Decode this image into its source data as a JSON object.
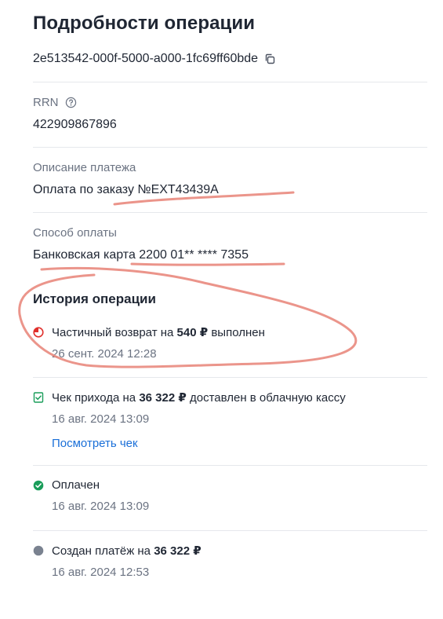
{
  "header": {
    "title": "Подробности операции",
    "operation_id": "2e513542-000f-5000-a000-1fc69ff60bde"
  },
  "rrn": {
    "label": "RRN",
    "value": "422909867896"
  },
  "description": {
    "label": "Описание платежа",
    "value": "Оплата по заказу №EXT43439A"
  },
  "payment_method": {
    "label": "Способ оплаты",
    "value": "Банковская карта 2200 01** **** 7355"
  },
  "history": {
    "title": "История операции",
    "events": [
      {
        "text_before": "Частичный возврат на ",
        "amount": "540 ₽",
        "text_after": " выполнен",
        "date": "26 сент. 2024 12:28",
        "icon": "partial-refund-icon",
        "icon_color": "#e0302c"
      },
      {
        "text_before": "Чек прихода на ",
        "amount": "36 322 ₽",
        "text_after": " доставлен в облачную кассу",
        "date": "16 авг. 2024 13:09",
        "link": "Посмотреть чек",
        "icon": "receipt-check-icon",
        "icon_color": "#1a9d5a"
      },
      {
        "text_before": "Оплачен",
        "amount": "",
        "text_after": "",
        "date": "16 авг. 2024 13:09",
        "icon": "paid-check-icon",
        "icon_color": "#1a9d5a"
      },
      {
        "text_before": "Создан платёж на ",
        "amount": "36 322 ₽",
        "text_after": "",
        "date": "16 авг. 2024 12:53",
        "icon": "created-dot-icon",
        "icon_color": "#7a8290"
      }
    ]
  },
  "colors": {
    "link": "#1a6fd8",
    "muted_text": "#6b7382",
    "annotation": "#e9897e"
  }
}
